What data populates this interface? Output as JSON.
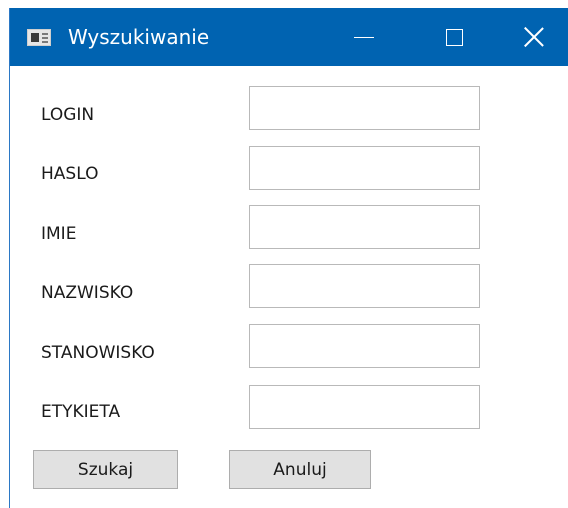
{
  "window": {
    "title": "Wyszukiwanie",
    "controls": {
      "minimize": "minimize",
      "maximize": "maximize",
      "close": "close"
    }
  },
  "form": {
    "fields": [
      {
        "label": "LOGIN",
        "value": ""
      },
      {
        "label": "HASLO",
        "value": ""
      },
      {
        "label": "IMIE",
        "value": ""
      },
      {
        "label": "NAZWISKO",
        "value": ""
      },
      {
        "label": "STANOWISKO",
        "value": ""
      },
      {
        "label": "ETYKIETA",
        "value": ""
      }
    ]
  },
  "buttons": {
    "search": "Szukaj",
    "cancel": "Anuluj"
  },
  "colors": {
    "titlebar": "#0063b1",
    "button_bg": "#e1e1e1",
    "field_border": "#b9b9b9"
  },
  "icons": {
    "app": "window-app-icon",
    "minimize": "minimize-icon",
    "maximize": "maximize-icon",
    "close": "close-icon"
  }
}
